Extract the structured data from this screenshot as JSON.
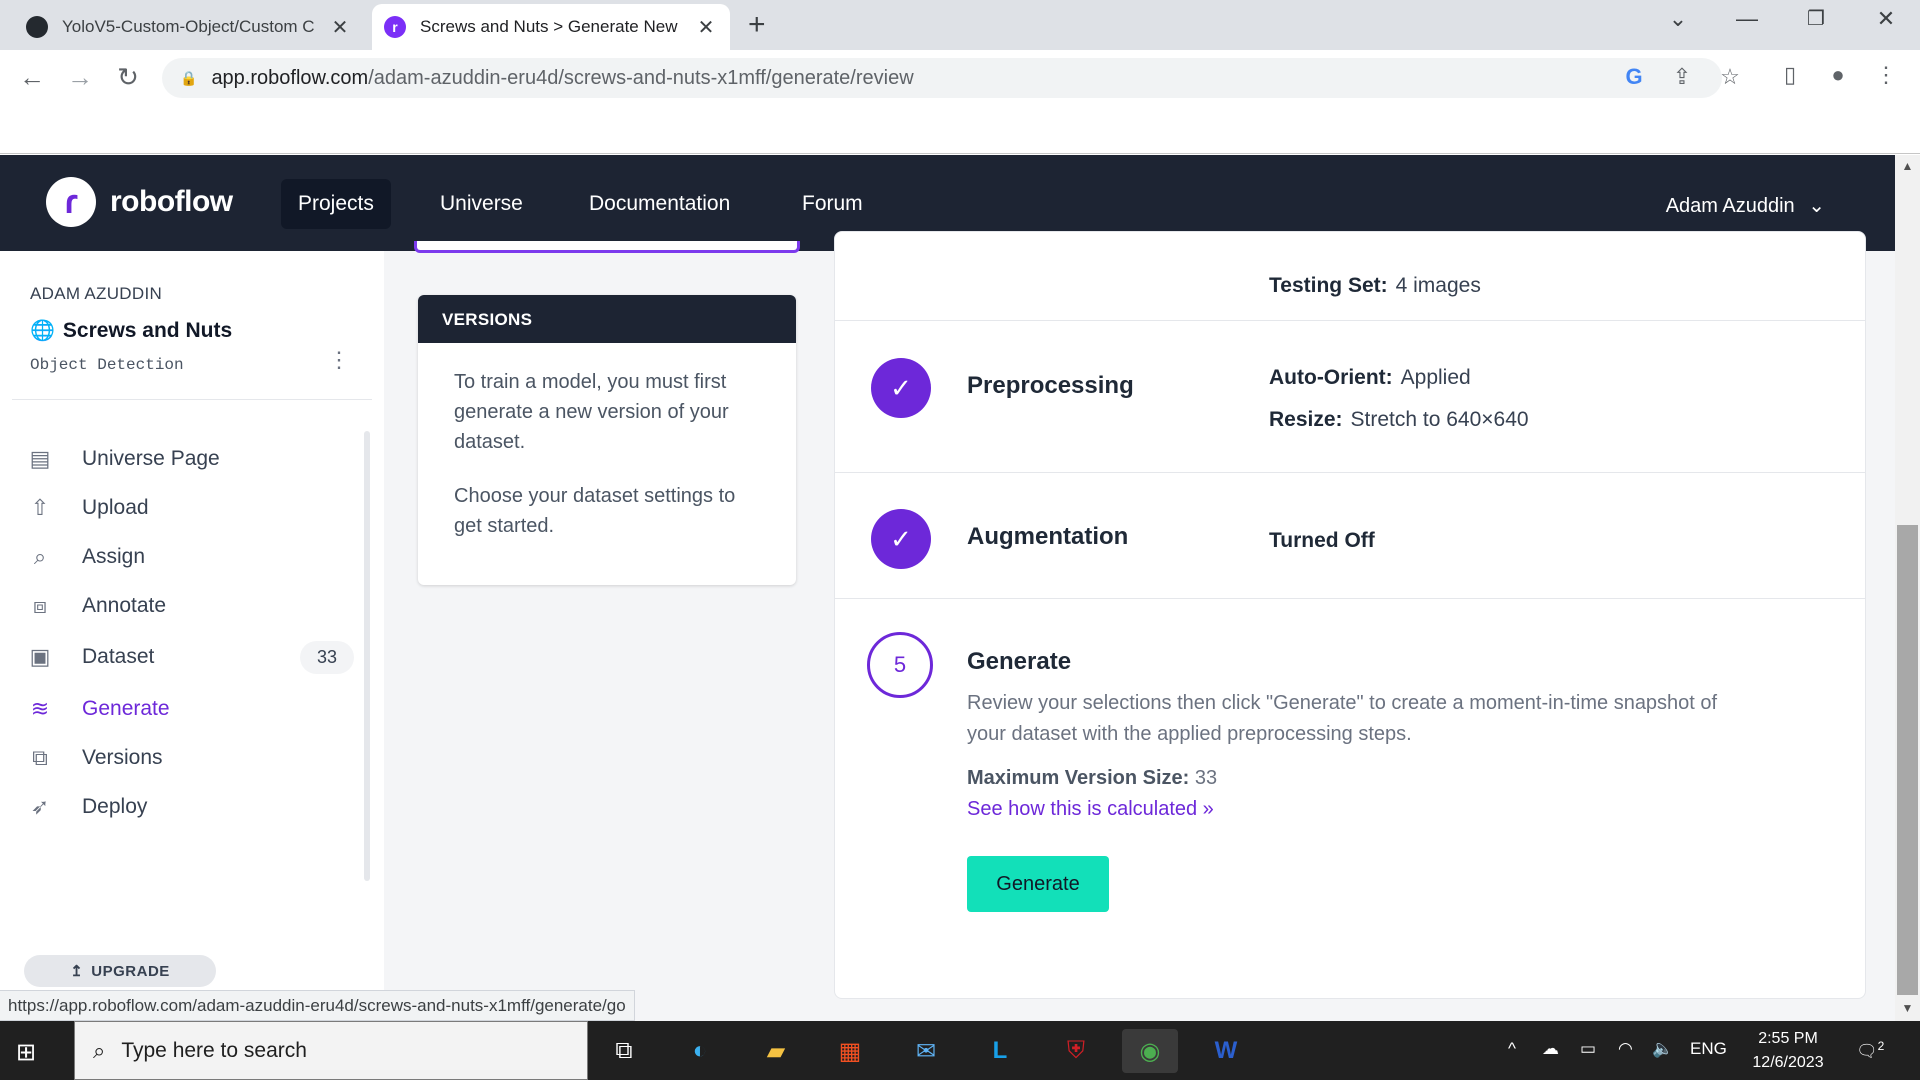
{
  "browser": {
    "tabs": [
      {
        "title": "YoloV5-Custom-Object/Custom C",
        "icon": "github-icon"
      },
      {
        "title": "Screws and Nuts > Generate New",
        "icon": "roboflow-icon"
      }
    ],
    "url_host": "app.roboflow.com",
    "url_path": "/adam-azuddin-eru4d/screws-and-nuts-x1mff/generate/review",
    "status_url": "https://app.roboflow.com/adam-azuddin-eru4d/screws-and-nuts-x1mff/generate/go"
  },
  "header": {
    "logo_text": "roboflow",
    "nav": [
      "Projects",
      "Universe",
      "Documentation",
      "Forum"
    ],
    "active_nav": "Projects",
    "user": "Adam Azuddin"
  },
  "sidebar": {
    "workspace": "ADAM AZUDDIN",
    "project_name": "Screws and Nuts",
    "project_type": "Object Detection",
    "items": [
      {
        "label": "Universe Page",
        "icon": "document-icon"
      },
      {
        "label": "Upload",
        "icon": "upload-icon"
      },
      {
        "label": "Assign",
        "icon": "search-icon"
      },
      {
        "label": "Annotate",
        "icon": "annotate-icon"
      },
      {
        "label": "Dataset",
        "icon": "images-icon",
        "badge": "33"
      },
      {
        "label": "Generate",
        "icon": "layers-icon",
        "active": true
      },
      {
        "label": "Versions",
        "icon": "folders-icon"
      },
      {
        "label": "Deploy",
        "icon": "rocket-icon"
      }
    ],
    "upgrade_label": "UPGRADE"
  },
  "versions_panel": {
    "title": "VERSIONS",
    "text1": "To train a model, you must first generate a new version of your dataset.",
    "text2": "Choose your dataset settings to get started."
  },
  "main": {
    "testing_label": "Testing Set:",
    "testing_value": "4 images",
    "preprocessing": {
      "title": "Preprocessing",
      "auto_orient_label": "Auto-Orient:",
      "auto_orient_value": "Applied",
      "resize_label": "Resize:",
      "resize_value": "Stretch to 640×640"
    },
    "augmentation": {
      "title": "Augmentation",
      "value": "Turned Off"
    },
    "generate": {
      "step_number": "5",
      "title": "Generate",
      "description": "Review your selections then click \"Generate\" to create a moment-in-time snapshot of your dataset with the applied preprocessing steps.",
      "max_size_label": "Maximum Version Size:",
      "max_size_value": "33",
      "calc_link": "See how this is calculated »",
      "button_label": "Generate"
    }
  },
  "taskbar": {
    "search_placeholder": "Type here to search",
    "language": "ENG",
    "time": "2:55 PM",
    "date": "12/6/2023",
    "notification_count": "2"
  },
  "colors": {
    "accent": "#6d28d9",
    "nav_bg": "#1d2433",
    "generate_button": "#12e0b9"
  }
}
